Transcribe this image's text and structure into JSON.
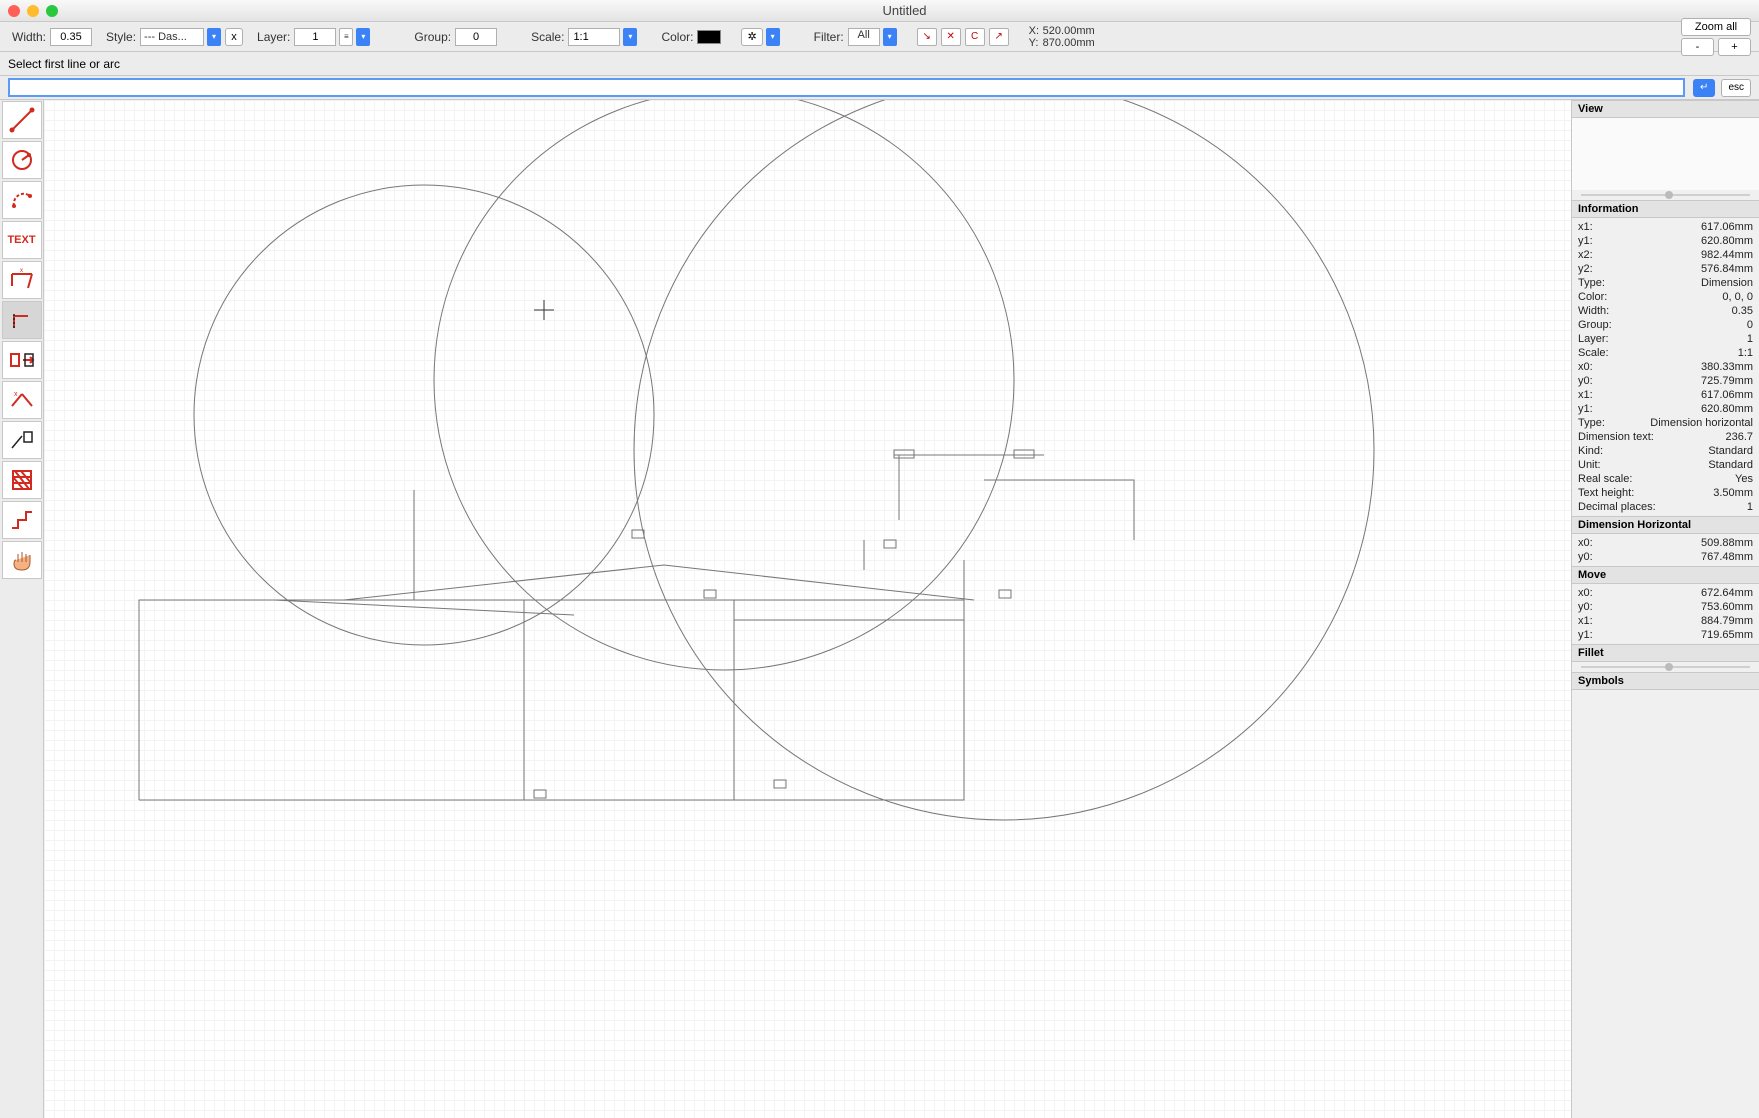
{
  "window": {
    "title": "Untitled"
  },
  "toolbar": {
    "width_label": "Width:",
    "width_value": "0.35",
    "style_label": "Style:",
    "style_value": "--- Das...",
    "clear_style": "x",
    "layer_label": "Layer:",
    "layer_value": "1",
    "group_label": "Group:",
    "group_value": "0",
    "scale_label": "Scale:",
    "scale_value": "1:1",
    "color_label": "Color:",
    "filter_label": "Filter:",
    "filter_value": "All",
    "coord": {
      "xlab": "X:",
      "xval": "520.00mm",
      "ylab": "Y:",
      "yval": "870.00mm"
    },
    "zoom_all": "Zoom all",
    "zoom_out": "-",
    "zoom_in": "+"
  },
  "prompt": {
    "text": "Select first line or arc",
    "enter_icon": "↵",
    "esc_label": "esc"
  },
  "tools": {
    "line": "line",
    "circle": "circle",
    "arc": "arc",
    "text": "TEXT",
    "dim": "dim",
    "corner": "corner",
    "mirror": "mirror",
    "trim": "trim",
    "erase": "erase",
    "hatch": "hatch",
    "stair": "stair",
    "pan": "pan"
  },
  "panels": {
    "view": {
      "title": "View"
    },
    "info": {
      "title": "Information",
      "rows": [
        {
          "k": "x1:",
          "v": "617.06mm"
        },
        {
          "k": "y1:",
          "v": "620.80mm"
        },
        {
          "k": "x2:",
          "v": "982.44mm"
        },
        {
          "k": "y2:",
          "v": "576.84mm"
        },
        {
          "k": "Type:",
          "v": "Dimension"
        },
        {
          "k": "Color:",
          "v": "0, 0, 0"
        },
        {
          "k": "Width:",
          "v": "0.35"
        },
        {
          "k": "Group:",
          "v": "0"
        },
        {
          "k": "Layer:",
          "v": "1"
        },
        {
          "k": "Scale:",
          "v": "1:1"
        },
        {
          "k": "x0:",
          "v": "380.33mm"
        },
        {
          "k": "y0:",
          "v": "725.79mm"
        },
        {
          "k": "x1:",
          "v": "617.06mm"
        },
        {
          "k": "y1:",
          "v": "620.80mm"
        },
        {
          "k": "Type:",
          "v": "Dimension horizontal"
        },
        {
          "k": "Dimension text:",
          "v": "236.7"
        },
        {
          "k": "Kind:",
          "v": "Standard"
        },
        {
          "k": "Unit:",
          "v": "Standard"
        },
        {
          "k": "Real scale:",
          "v": "Yes"
        },
        {
          "k": "Text height:",
          "v": "3.50mm"
        },
        {
          "k": "Decimal places:",
          "v": "1"
        }
      ]
    },
    "dimh": {
      "title": "Dimension Horizontal",
      "rows": [
        {
          "k": "x0:",
          "v": "509.88mm"
        },
        {
          "k": "y0:",
          "v": "767.48mm"
        }
      ]
    },
    "move": {
      "title": "Move",
      "rows": [
        {
          "k": "x0:",
          "v": "672.64mm"
        },
        {
          "k": "y0:",
          "v": "753.60mm"
        },
        {
          "k": "x1:",
          "v": "884.79mm"
        },
        {
          "k": "y1:",
          "v": "719.65mm"
        }
      ]
    },
    "fillet": {
      "title": "Fillet"
    },
    "symbols": {
      "title": "Symbols"
    }
  }
}
